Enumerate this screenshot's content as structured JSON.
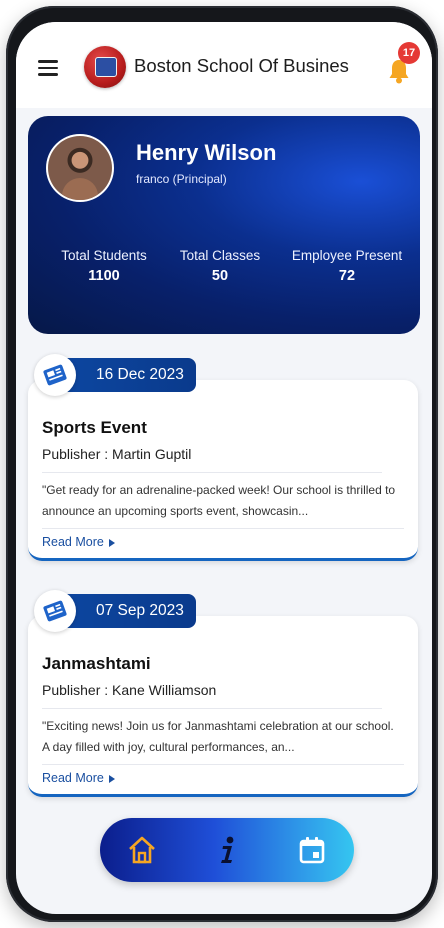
{
  "header": {
    "school_name": "Boston School Of Busines",
    "notification_count": "17"
  },
  "profile": {
    "name": "Henry Wilson",
    "role": "franco (Principal)",
    "stats": [
      {
        "label": "Total Students",
        "value": "1100"
      },
      {
        "label": "Total Classes",
        "value": "50"
      },
      {
        "label": "Employee Present",
        "value": "72"
      }
    ]
  },
  "news": [
    {
      "date": "16 Dec 2023",
      "title": "Sports Event",
      "publisher": "Publisher : Martin Guptil",
      "excerpt": "\"Get ready for an adrenaline-packed week! Our school is thrilled to announce an upcoming sports event, showcasin...",
      "read_more": "Read More"
    },
    {
      "date": "07 Sep 2023",
      "title": "Janmashtami",
      "publisher": "Publisher : Kane Williamson",
      "excerpt": "\"Exciting news! Join us for Janmashtami celebration at our school. A day filled with joy, cultural performances, an...",
      "read_more": "Read More"
    }
  ],
  "bottom_nav": {
    "items": [
      "home-icon",
      "info-icon",
      "calendar-icon"
    ]
  },
  "colors": {
    "primary": "#0d47a1",
    "badge": "#e53935",
    "bell": "#f5a623"
  }
}
